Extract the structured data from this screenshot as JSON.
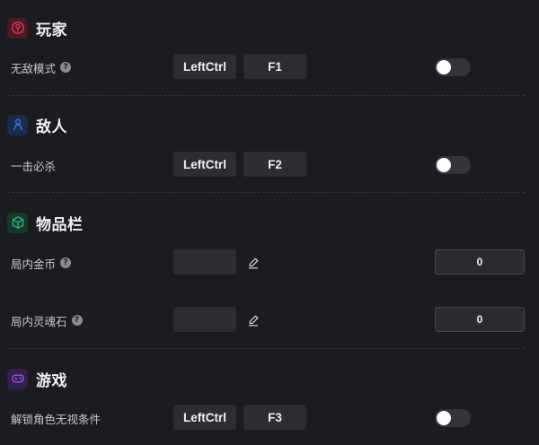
{
  "colors": {
    "background": "#1b1c20",
    "player_accent": "#e23c5a",
    "enemy_accent": "#3f7be6",
    "inventory_accent": "#2fb57b",
    "game_accent": "#9a55e8"
  },
  "sections": [
    {
      "title": "玩家",
      "icon": "player-badge-icon",
      "rows": [
        {
          "label": "无敌模式",
          "help": "?",
          "keys": [
            "LeftCtrl",
            "F1"
          ],
          "toggle_on": false
        }
      ]
    },
    {
      "title": "敌人",
      "icon": "enemy-person-icon",
      "rows": [
        {
          "label": "一击必杀",
          "keys": [
            "LeftCtrl",
            "F2"
          ],
          "toggle_on": false
        }
      ]
    },
    {
      "title": "物品栏",
      "icon": "inventory-cube-icon",
      "rows": [
        {
          "label": "局内金币",
          "help": "?",
          "value": "0",
          "edit_icon": "pencil-icon"
        },
        {
          "label": "局内灵魂石",
          "help": "?",
          "value": "0",
          "edit_icon": "pencil-icon"
        }
      ]
    },
    {
      "title": "游戏",
      "icon": "gamepad-icon",
      "rows": [
        {
          "label": "解锁角色无视条件",
          "keys": [
            "LeftCtrl",
            "F3"
          ],
          "toggle_on": false
        }
      ]
    }
  ]
}
